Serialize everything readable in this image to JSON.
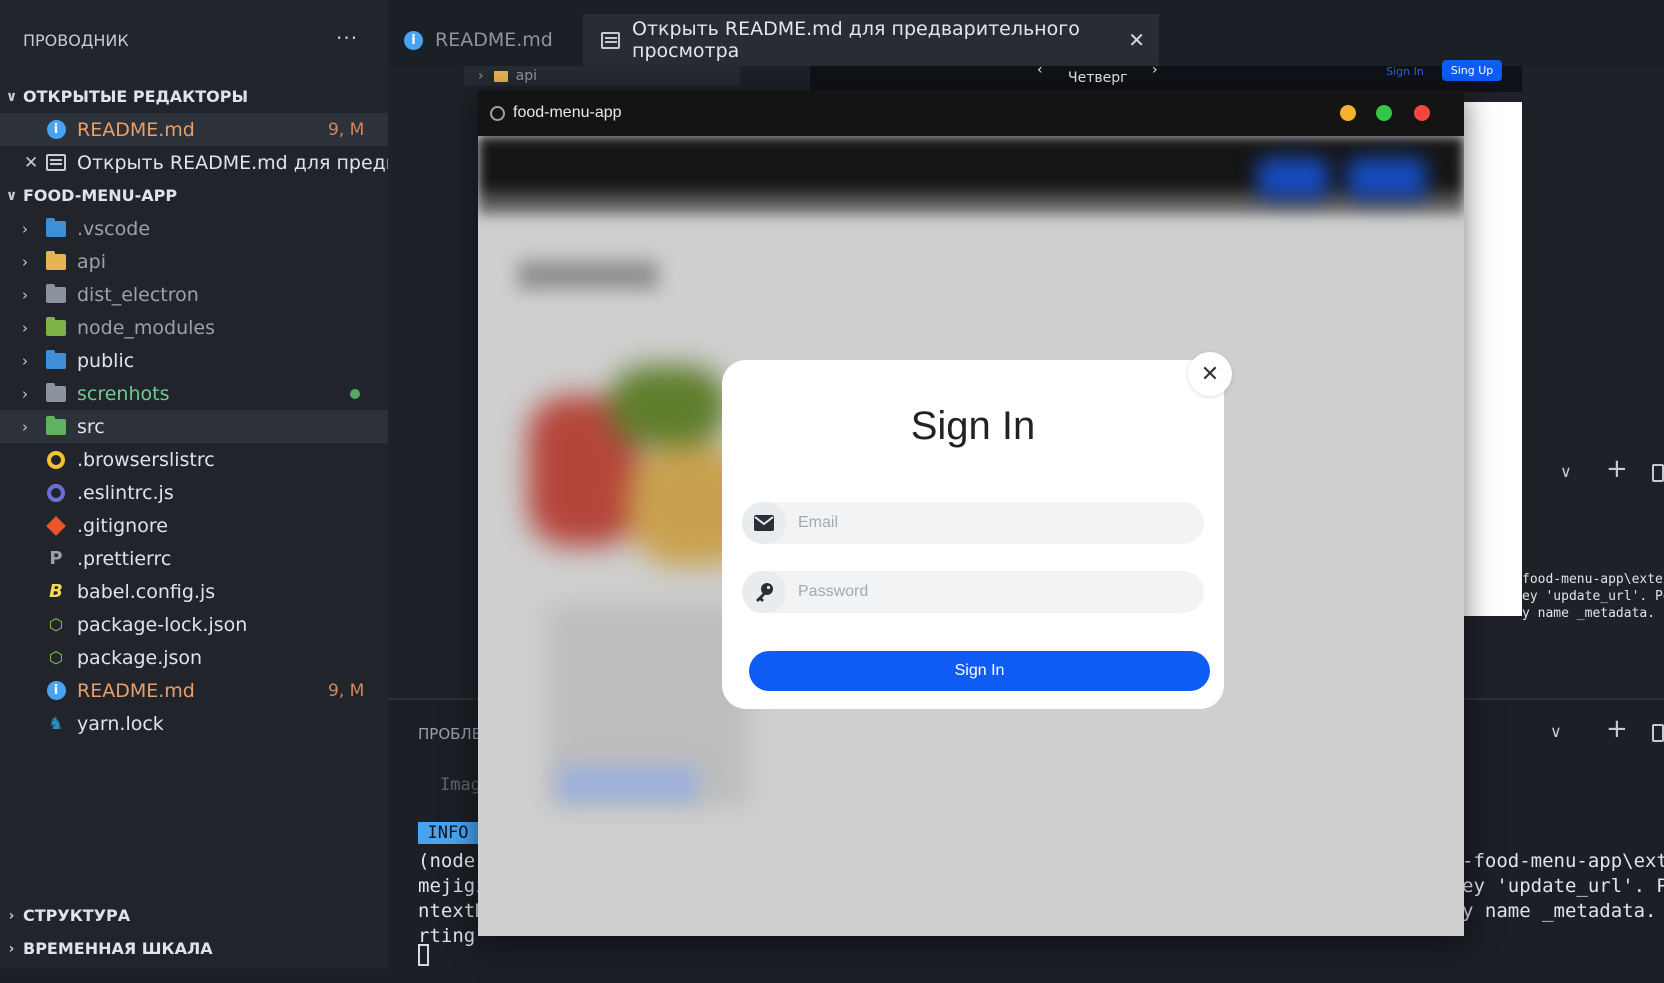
{
  "explorer": {
    "title": "ПРОВОДНИК",
    "more_glyph": "···",
    "open_editors_header": "ОТКРЫТЫЕ РЕДАКТОРЫ",
    "open_editors": [
      {
        "label": "README.md",
        "badge": "9, M"
      },
      {
        "label": "Открыть README.md для предва..."
      }
    ],
    "project_header": "FOOD-MENU-APP",
    "items": [
      {
        "label": ".vscode",
        "icon": "vscode-folder-icon"
      },
      {
        "label": "api",
        "icon": "api-folder-icon"
      },
      {
        "label": "dist_electron",
        "icon": "folder-icon"
      },
      {
        "label": "node_modules",
        "icon": "node-folder-icon"
      },
      {
        "label": "public",
        "icon": "public-folder-icon"
      },
      {
        "label": "screnhots",
        "icon": "folder-icon"
      },
      {
        "label": "src",
        "icon": "src-folder-icon"
      },
      {
        "label": ".browserslistrc",
        "icon": "browserslist-icon"
      },
      {
        "label": ".eslintrc.js",
        "icon": "eslint-icon"
      },
      {
        "label": ".gitignore",
        "icon": "git-icon"
      },
      {
        "label": ".prettierrc",
        "icon": "prettier-icon"
      },
      {
        "label": "babel.config.js",
        "icon": "babel-icon"
      },
      {
        "label": "package-lock.json",
        "icon": "nodejs-icon"
      },
      {
        "label": "package.json",
        "icon": "nodejs-icon"
      },
      {
        "label": "README.md",
        "icon": "info-icon",
        "badge": "9, M"
      },
      {
        "label": "yarn.lock",
        "icon": "yarn-icon"
      }
    ],
    "outline_header": "СТРУКТУРА",
    "timeline_header": "ВРЕМЕННАЯ ШКАЛА"
  },
  "tabs": [
    {
      "label": "README.md"
    },
    {
      "label": "Открыть README.md для предварительного просмотра"
    }
  ],
  "background_preview": {
    "tree_item": "api",
    "day": "Четверг",
    "sign_in": "Sign In",
    "sign_up": "Sing Up"
  },
  "panel": {
    "problems_tab": "ПРОБЛЕ",
    "hint": "Imag",
    "info_chip": "INFO",
    "left_lines": [
      "(node:",
      "mejigi",
      "ntextM",
      "rting "
    ],
    "right_lines": [
      "-food-menu-app\\exte",
      "ey 'update_url'. P",
      "y name _metadata. "
    ],
    "right_lines_upper": [
      "food-menu-app\\exter",
      "ey 'update_url'. Pe",
      "y name _metadata. I"
    ]
  },
  "app_window": {
    "title": "food-menu-app",
    "controls": [
      "minimize",
      "maximize",
      "close"
    ]
  },
  "modal": {
    "title": "Sign In",
    "email_placeholder": "Email",
    "password_placeholder": "Password",
    "submit_label": "Sign In",
    "close_glyph": "✕"
  },
  "colors": {
    "accent": "#0f5cf4",
    "modified": "#e8a06a",
    "untracked": "#73c991",
    "info_blue": "#4aa3f0"
  }
}
